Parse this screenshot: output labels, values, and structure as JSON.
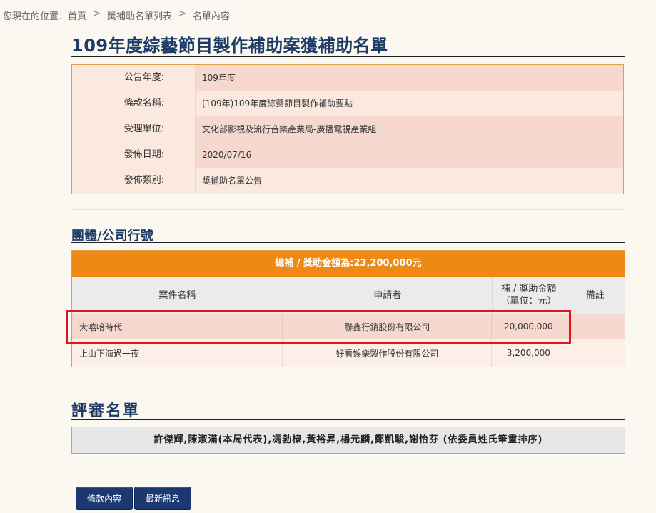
{
  "breadcrumb": {
    "prefix": "您現在的位置：",
    "items": [
      "首頁",
      "獎補助名單列表",
      "名單內容"
    ],
    "separator": ">"
  },
  "page_title": "109年度綜藝節目製作補助案獲補助名單",
  "info": [
    {
      "label": "公告年度:",
      "value": "109年度"
    },
    {
      "label": "條款名稱:",
      "value": "(109年)109年度綜藝節目製作補助要點"
    },
    {
      "label": "受理單位:",
      "value": "文化部影視及流行音樂產業局-廣播電視產業組"
    },
    {
      "label": "發佈日期:",
      "value": "2020/07/16"
    },
    {
      "label": "發佈類別:",
      "value": "獎補助名單公告"
    }
  ],
  "section_org": "團體/公司行號",
  "grant_table": {
    "total": "總補 / 獎助金額為:23,200,000元",
    "headers": [
      "案件名稱",
      "申請者",
      "補 / 獎助金額\n（單位：元）",
      "備註"
    ],
    "header_amount_line1": "補 / 獎助金額",
    "header_amount_line2": "（單位：元）",
    "rows": [
      {
        "name": "大嘻哈時代",
        "applicant": "聯鑫行銷股份有限公司",
        "amount": "20,000,000",
        "note": ""
      },
      {
        "name": "上山下海過一夜",
        "applicant": "好看娛樂製作股份有限公司",
        "amount": "3,200,000",
        "note": ""
      }
    ]
  },
  "section_review": "評審名單",
  "reviewers": "許傑輝,陳淑滿(本局代表),馮勃棣,黃裕昇,楊元麟,鄭凱駿,謝怡芬 (依委員姓氏筆畫排序)",
  "buttons": {
    "terms": "條款內容",
    "news": "最新訊息"
  },
  "colors": {
    "title": "#1e3a66",
    "total_bar": "#ee8a14",
    "highlight": "#e0161b",
    "button": "#1b3870"
  }
}
